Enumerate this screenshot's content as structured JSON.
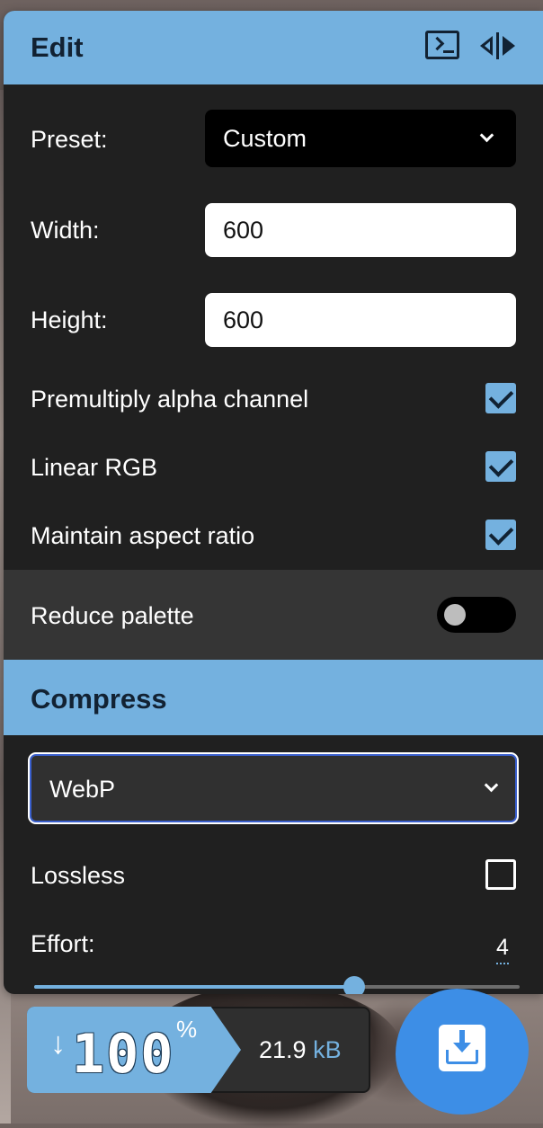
{
  "edit": {
    "title": "Edit",
    "preset_label": "Preset:",
    "preset_value": "Custom",
    "width_label": "Width:",
    "width_value": "600",
    "height_label": "Height:",
    "height_value": "600",
    "options": [
      {
        "label": "Premultiply alpha channel",
        "checked": true
      },
      {
        "label": "Linear RGB",
        "checked": true
      },
      {
        "label": "Maintain aspect ratio",
        "checked": true
      }
    ],
    "reduce_palette_label": "Reduce palette",
    "reduce_palette_on": false
  },
  "compress": {
    "title": "Compress",
    "format_value": "WebP",
    "lossless_label": "Lossless",
    "lossless_checked": false,
    "effort_label": "Effort:",
    "effort_value": "4",
    "effort_fraction": 0.66
  },
  "results": {
    "arrow": "↓",
    "percent_value": "100",
    "percent_sign": "%",
    "size_value": "21.9",
    "size_unit": "kB"
  },
  "colors": {
    "accent": "#74b1df",
    "panel": "#202020",
    "download": "#3d8ee6"
  },
  "icons": [
    "terminal-icon",
    "side-by-side-icon",
    "chevron-down-icon",
    "download-icon"
  ]
}
